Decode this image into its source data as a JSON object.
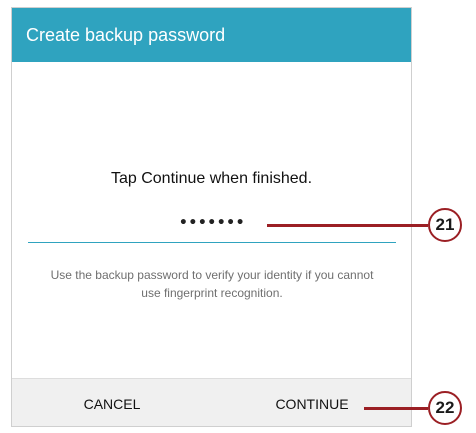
{
  "dialog": {
    "title": "Create backup password",
    "instruction": "Tap Continue when finished.",
    "password_value": "•••••••",
    "help_text": "Use the backup password to verify your identity if you cannot use fingerprint recognition.",
    "buttons": {
      "cancel": "CANCEL",
      "continue": "CONTINUE"
    }
  },
  "callouts": [
    {
      "label": "21"
    },
    {
      "label": "22"
    }
  ],
  "colors": {
    "title_bar": "#2fa3bf",
    "field_underline": "#2fa3bf",
    "callout": "#9b1f24",
    "button_bar": "#f0f0f0"
  }
}
